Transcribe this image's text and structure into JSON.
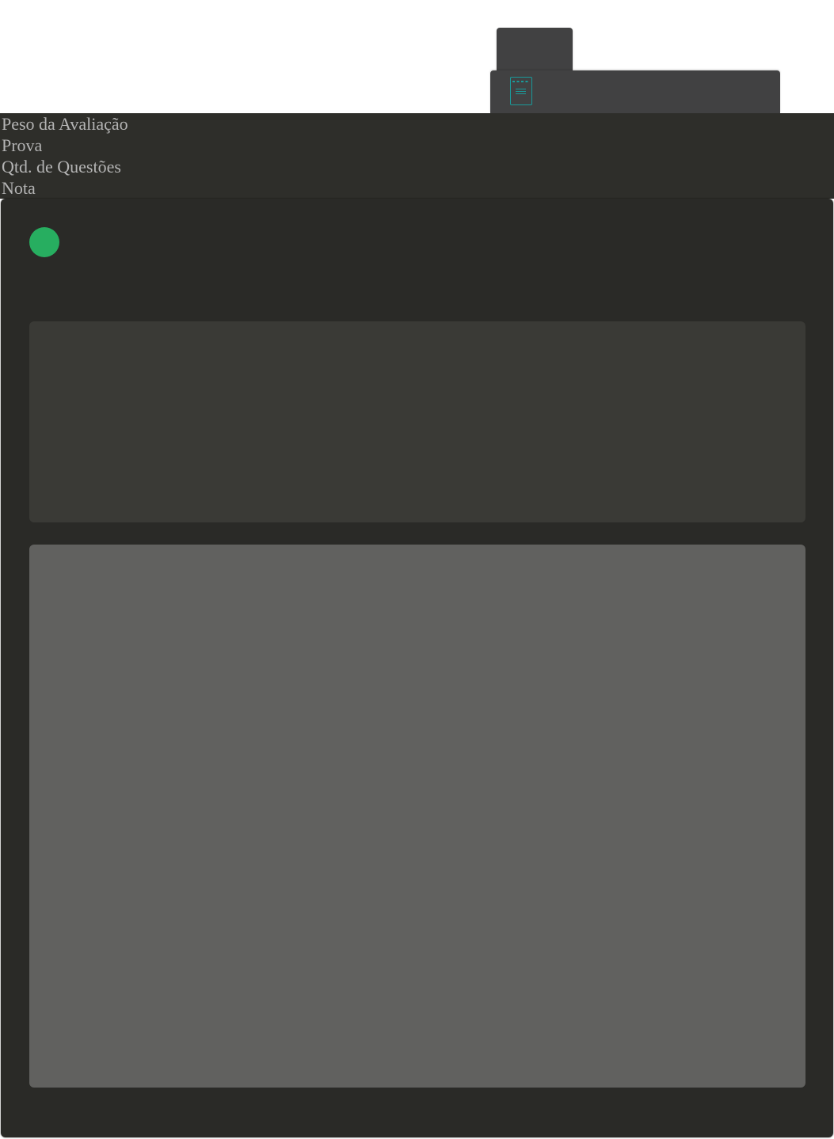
{
  "colors": {
    "status_dot": "#27ae60",
    "icon_accent": "#1a9a9a"
  },
  "header": {
    "labels": [
      "Peso da Avaliação",
      "Prova",
      "Qtd. de Questões",
      "Nota"
    ]
  },
  "icons": {
    "toolbar_doc": "document-icon",
    "status": "status-dot"
  }
}
